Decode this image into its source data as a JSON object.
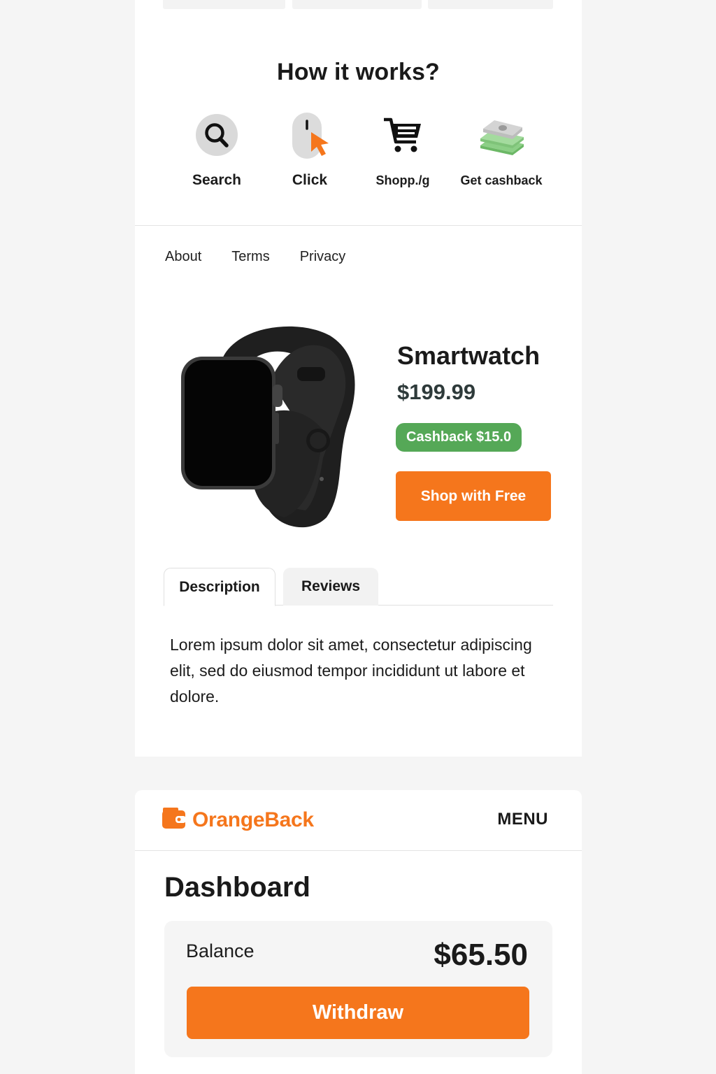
{
  "how_it_works": {
    "title": "How it works?",
    "steps": [
      {
        "label": "Search",
        "icon": "search-icon"
      },
      {
        "label": "Click",
        "icon": "mouse-click-icon"
      },
      {
        "label": "Shopp./g",
        "icon": "shopping-cart-icon"
      },
      {
        "label": "Get cashback",
        "icon": "cash-stack-icon"
      }
    ]
  },
  "footer_links": [
    "About",
    "Terms",
    "Privacy"
  ],
  "product": {
    "name": "Smartwatch",
    "price": "$199.99",
    "cashback": "Cashback $15.0",
    "shop_button": "Shop with Free",
    "image": "smartwatch-image"
  },
  "tabs": {
    "items": [
      "Description",
      "Reviews"
    ],
    "active": "Description",
    "description": "Lorem ipsum dolor sit amet, consectetur adipis­cing elit, sed do eiusmod tempor incididunt ut labore et dolore."
  },
  "header": {
    "brand": "OrangeBack",
    "brand_icon": "wallet-icon",
    "menu": "MENU"
  },
  "dashboard": {
    "title": "Dashboard",
    "balance_label": "Balance",
    "balance_amount": "$65.50",
    "withdraw_button": "Withdraw"
  },
  "colors": {
    "accent": "#f5761c",
    "cashback_green": "#55a857",
    "background": "#f5f5f5"
  }
}
